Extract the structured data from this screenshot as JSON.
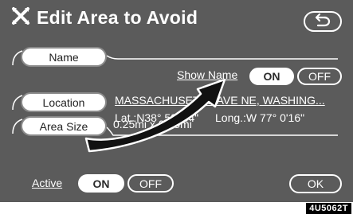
{
  "header": {
    "title": "Edit Area to Avoid",
    "title_icon": "crossed-swords-icon",
    "back_icon": "back-arrow-icon"
  },
  "name_section": {
    "name_button": "Name",
    "show_name_label": "Show Name",
    "on_label": "ON",
    "off_label": "OFF",
    "selected": "ON"
  },
  "location_section": {
    "location_button": "Location",
    "address": "MASSACHUSETTS AVE NE, WASHING...",
    "latitude": "Lat.:N38° 53' 34\"",
    "longitude": "Long.:W 77° 0'16\""
  },
  "area_section": {
    "area_size_button": "Area Size",
    "size": "0.25mi x 0.25mi"
  },
  "footer": {
    "active_label": "Active",
    "on_label": "ON",
    "off_label": "OFF",
    "selected": "ON",
    "ok_label": "OK"
  },
  "reference_code": "4U5062T",
  "colors": {
    "screen_background": "#5b5b5b",
    "text": "#ffffff",
    "selected_background": "#ffffff",
    "arrow": "#111111"
  }
}
